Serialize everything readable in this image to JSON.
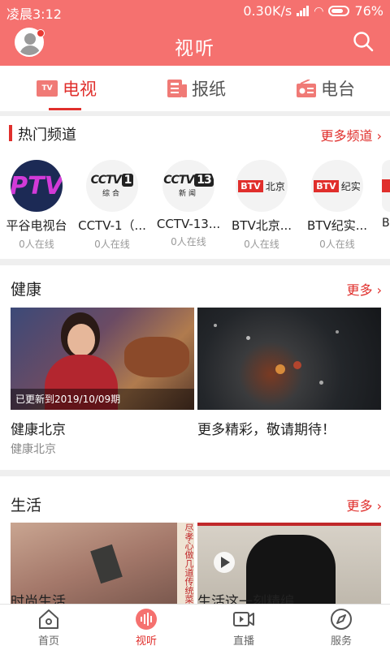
{
  "status": {
    "time": "凌晨3:12",
    "speed": "0.30K/s",
    "battery": "76%"
  },
  "header": {
    "title": "视听"
  },
  "tabs": [
    {
      "label": "电视",
      "icon": "tv-icon",
      "icon_text": "TV",
      "active": true
    },
    {
      "label": "报纸",
      "icon": "newspaper-icon",
      "active": false
    },
    {
      "label": "电台",
      "icon": "radio-icon",
      "active": false
    }
  ],
  "hot": {
    "title": "热门频道",
    "more": "更多频道",
    "channels": [
      {
        "name": "平谷电视台",
        "online": "0人在线",
        "logo": "PTV"
      },
      {
        "name": "CCTV-1（...",
        "online": "0人在线",
        "logo": "CCTV",
        "logo_num": "1",
        "logo_sub": "综合"
      },
      {
        "name": "CCTV-13...",
        "online": "0人在线",
        "logo": "CCTV",
        "logo_num": "13",
        "logo_sub": "新闻"
      },
      {
        "name": "BTV北京...",
        "online": "0人在线",
        "logo": "BTV",
        "logo_sub": "北京"
      },
      {
        "name": "BTV纪实...",
        "online": "0人在线",
        "logo": "BTV",
        "logo_sub": "纪实"
      },
      {
        "name": "B",
        "online": ""
      }
    ]
  },
  "health": {
    "title": "健康",
    "more": "更多",
    "cards": [
      {
        "title": "健康北京",
        "subtitle": "健康北京",
        "badge": "已更新到2019/10/09期"
      },
      {
        "title": "更多精彩，敬请期待！",
        "subtitle": ""
      }
    ]
  },
  "life": {
    "title": "生活",
    "more": "更多",
    "image_caption": "尽孝心做几道传统菜",
    "cards": [
      {
        "title": "时尚生活"
      },
      {
        "title": "生活这一刻精编"
      }
    ]
  },
  "nav": [
    {
      "label": "首页",
      "icon": "home-icon",
      "active": false
    },
    {
      "label": "视听",
      "icon": "audio-icon",
      "active": true
    },
    {
      "label": "直播",
      "icon": "live-video-icon",
      "active": false
    },
    {
      "label": "服务",
      "icon": "compass-icon",
      "active": false
    }
  ],
  "colors": {
    "header": "#f5716f",
    "accent": "#e02f2c"
  }
}
